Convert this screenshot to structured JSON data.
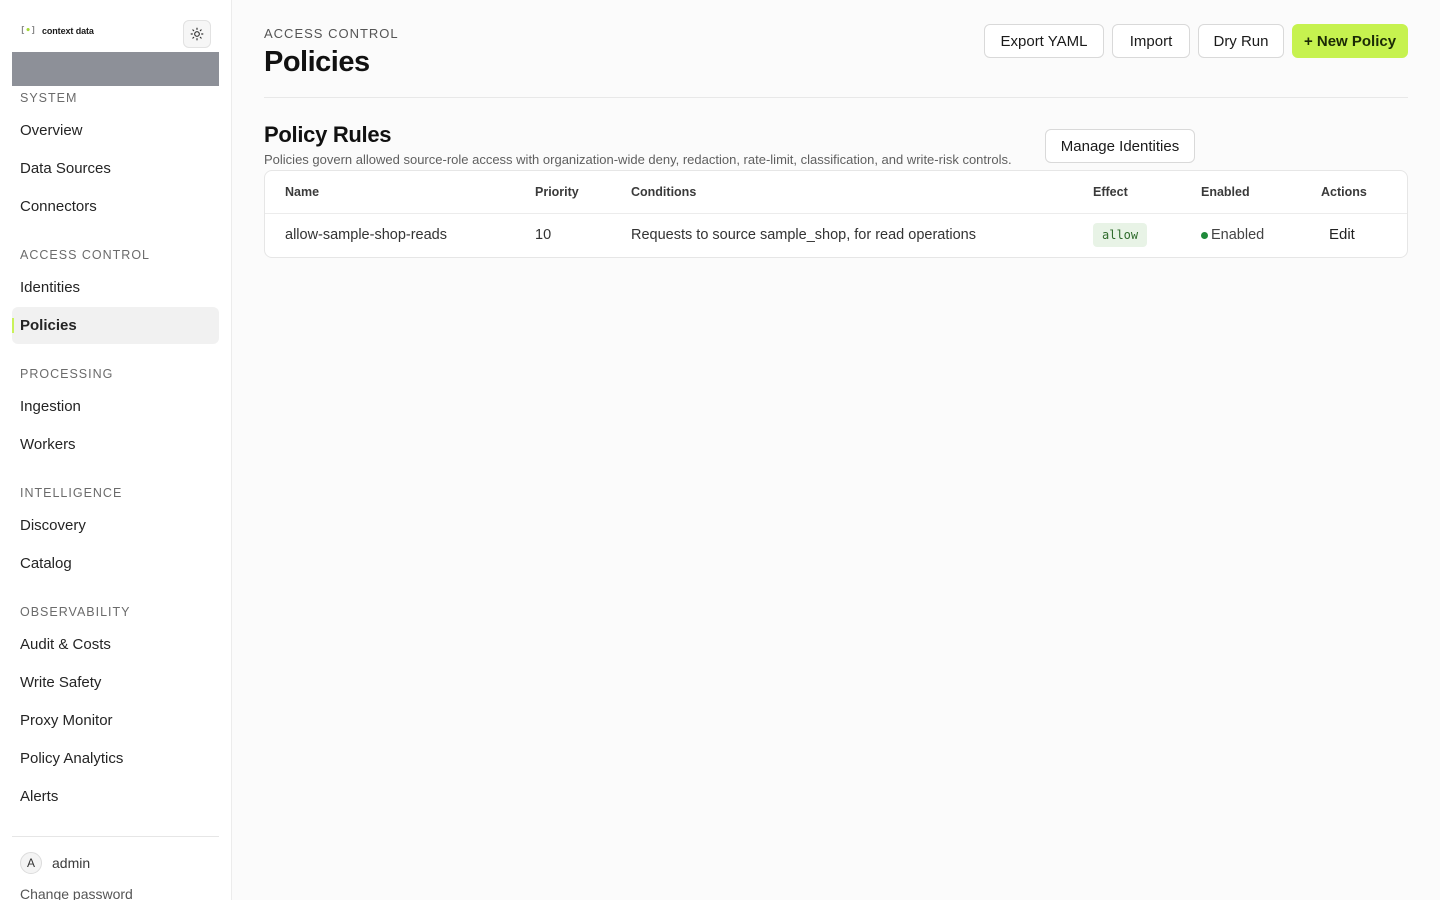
{
  "brand": {
    "mark_left": "[",
    "mark_dot": "•",
    "mark_right": "]",
    "name": "context data"
  },
  "sidebar": {
    "sections": [
      {
        "title": "SYSTEM",
        "items": [
          "Overview",
          "Data Sources",
          "Connectors"
        ]
      },
      {
        "title": "ACCESS CONTROL",
        "items": [
          "Identities",
          "Policies"
        ]
      },
      {
        "title": "PROCESSING",
        "items": [
          "Ingestion",
          "Workers"
        ]
      },
      {
        "title": "INTELLIGENCE",
        "items": [
          "Discovery",
          "Catalog"
        ]
      },
      {
        "title": "OBSERVABILITY",
        "items": [
          "Audit & Costs",
          "Write Safety",
          "Proxy Monitor",
          "Policy Analytics",
          "Alerts"
        ]
      }
    ],
    "active_item": "Policies",
    "user": {
      "avatar_letter": "A",
      "name": "admin"
    },
    "change_password": "Change password"
  },
  "header": {
    "eyebrow": "ACCESS CONTROL",
    "title": "Policies",
    "buttons": {
      "export": "Export YAML",
      "import": "Import",
      "dry_run": "Dry Run",
      "new_policy": "+ New Policy"
    }
  },
  "section": {
    "title": "Policy Rules",
    "description": "Policies govern allowed source-role access with organization-wide deny, redaction, rate-limit, classification, and write-risk controls.",
    "manage_button": "Manage Identities"
  },
  "table": {
    "columns": {
      "name": "Name",
      "priority": "Priority",
      "conditions": "Conditions",
      "effect": "Effect",
      "enabled": "Enabled",
      "actions": "Actions"
    },
    "rows": [
      {
        "name": "allow-sample-shop-reads",
        "priority": "10",
        "conditions": "Requests to source sample_shop, for read operations",
        "effect": "allow",
        "enabled": "Enabled",
        "action": "Edit"
      }
    ]
  },
  "colors": {
    "accent": "#c6f24f",
    "enabled_dot": "#1f8a3a",
    "effect_bg": "#e8f3e6"
  }
}
